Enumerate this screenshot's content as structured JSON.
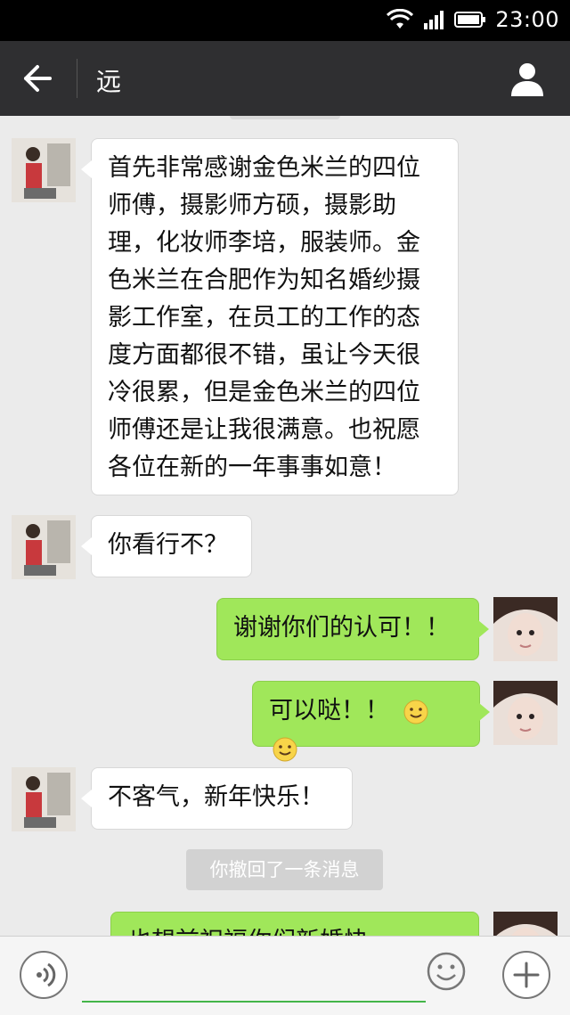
{
  "status_bar": {
    "time": "23:00",
    "icons": [
      "wifi-icon",
      "signal-icon",
      "battery-icon"
    ]
  },
  "header": {
    "title": "远",
    "back_icon": "arrow-left-icon",
    "profile_icon": "person-icon"
  },
  "messages": [
    {
      "side": "left",
      "text": "首先非常感谢金色米兰的四位师傅，摄影师方硕，摄影助理，化妆师李培，服装师。金色米兰在合肥作为知名婚纱摄影工作室，在员工的工作的态度方面都很不错，虽让今天很冷很累，但是金色米兰的四位师傅还是让我很满意。也祝愿各位在新的一年事事如意！"
    },
    {
      "side": "left",
      "text": "你看行不？"
    },
    {
      "side": "right",
      "text": "谢谢你们的认可！！"
    },
    {
      "side": "right",
      "text": "可以哒！！"
    },
    {
      "side": "left",
      "text": "不客气，新年快乐！"
    },
    {
      "side": "system",
      "text": "你撤回了一条消息"
    },
    {
      "side": "right",
      "text": "也想前祝福你们新婚快"
    }
  ],
  "input_bar": {
    "voice_icon": "voice-icon",
    "emoji_icon": "smile-icon",
    "plus_icon": "plus-icon",
    "placeholder": ""
  },
  "colors": {
    "title_bar": "#2f2f31",
    "chat_bg": "#ebebeb",
    "bubble_left": "#ffffff",
    "bubble_right": "#a0e75a",
    "input_underline": "#44b549"
  }
}
